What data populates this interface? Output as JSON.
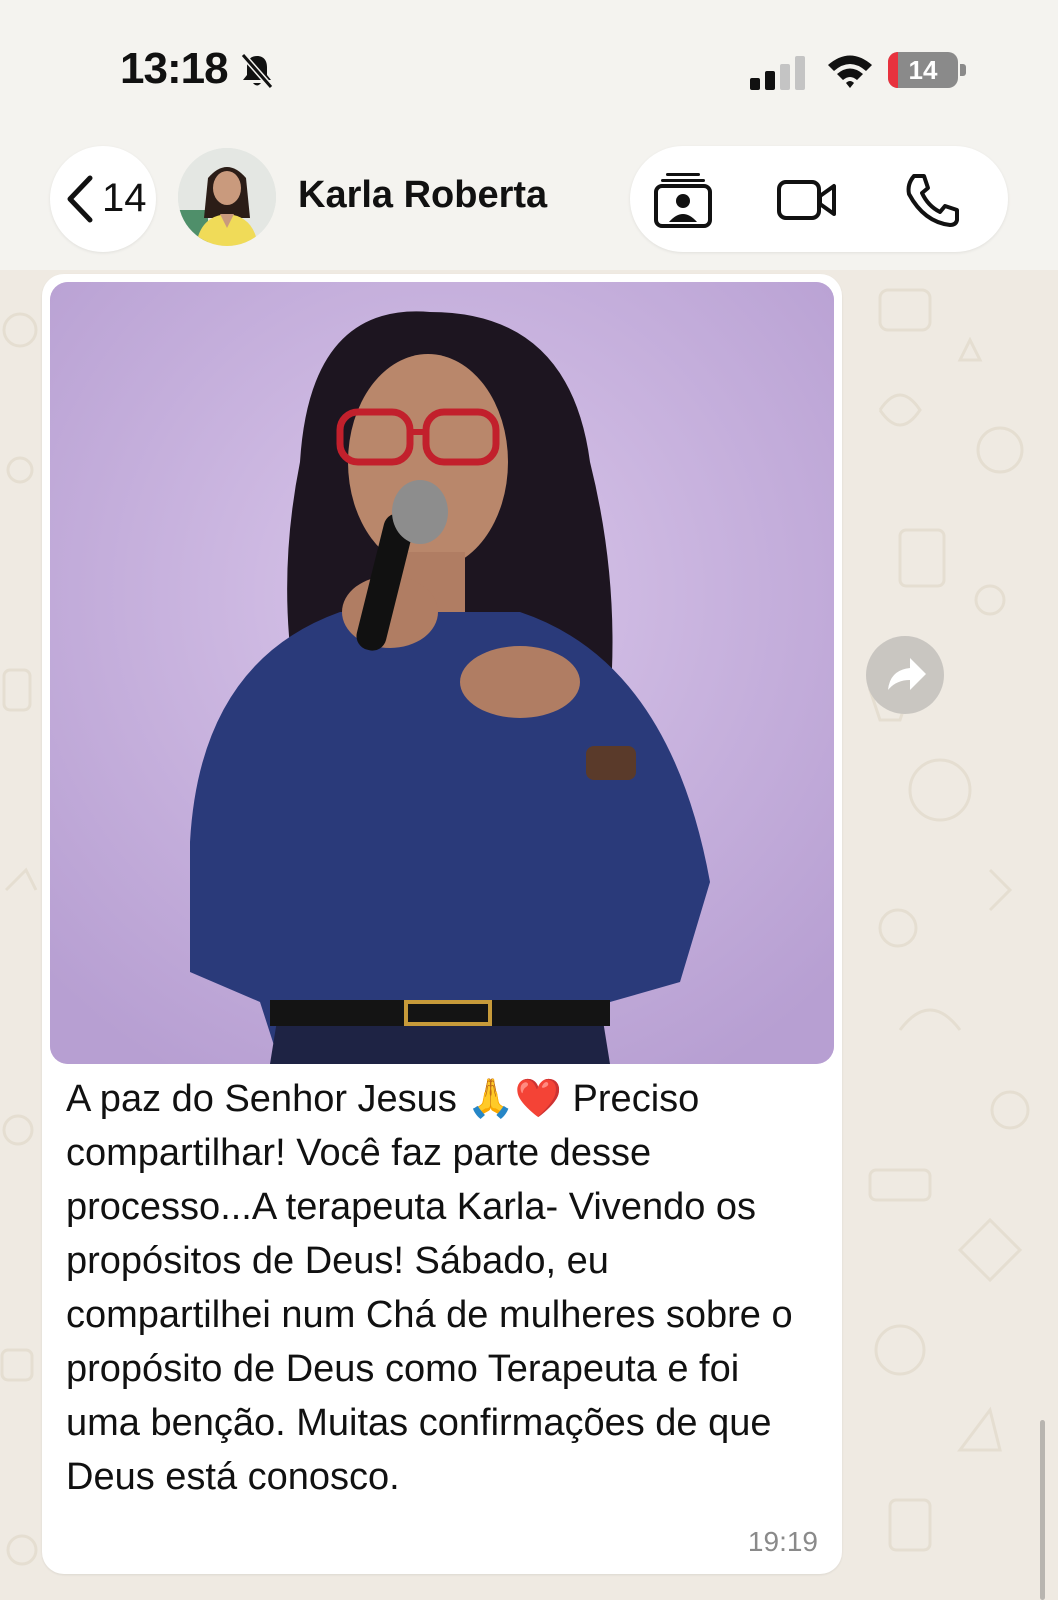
{
  "status_bar": {
    "time": "13:18",
    "battery_level": "14",
    "battery_fraction": 0.14,
    "silent_icon": "bell-slash-icon",
    "signal_bars": 2,
    "colors": {
      "battery_low": "#e8323e"
    }
  },
  "header": {
    "back_count": "14",
    "contact_name": "Karla Roberta",
    "avatar_icon": "contact-avatar",
    "actions": [
      "contact-card-icon",
      "video-call-icon",
      "phone-call-icon"
    ]
  },
  "message": {
    "caption": "A paz do Senhor Jesus 🙏❤️ Preciso compartilhar! Você faz parte desse processo...A terapeuta Karla- Vivendo os propósitos de Deus! Sábado, eu compartilhei num Chá de mulheres sobre o propósito de Deus como Terapeuta e foi uma benção. Muitas confirmações de que Deus está conosco.",
    "time": "19:19",
    "photo_icon": "woman-speaking-with-microphone-photo"
  },
  "chat": {
    "forward_icon": "forward-arrow-icon",
    "background_color": "#efeae2"
  }
}
